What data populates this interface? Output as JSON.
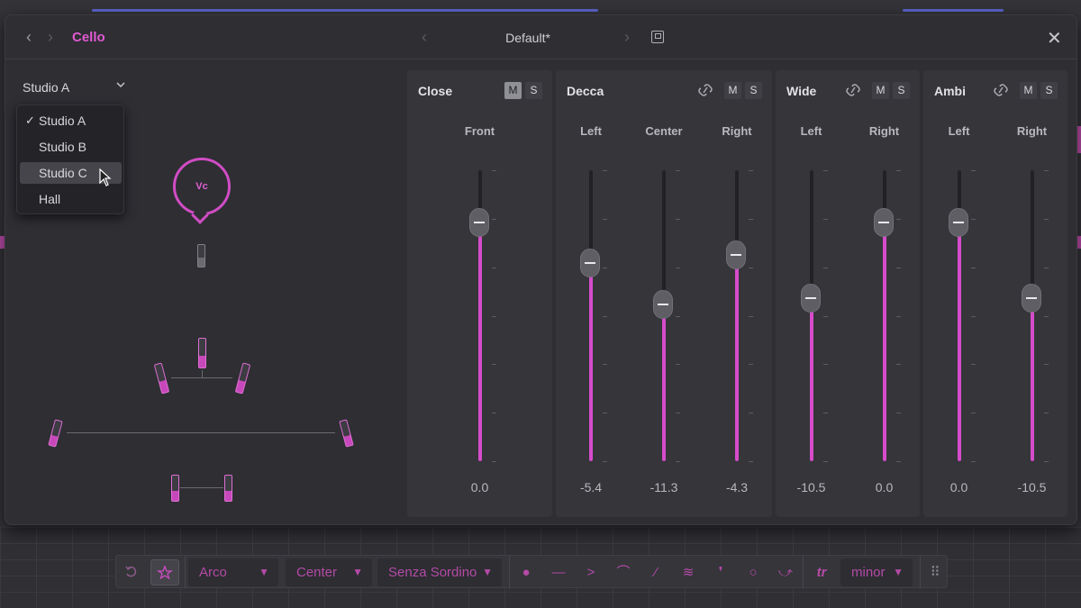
{
  "window": {
    "title": "Cello",
    "preset": "Default*"
  },
  "room": {
    "selected": "Studio A",
    "options": [
      "Studio A",
      "Studio B",
      "Studio C",
      "Hall"
    ],
    "hovered": "Studio C"
  },
  "stage": {
    "instrument": "Vc"
  },
  "panels": [
    {
      "name": "Close",
      "linked": false,
      "mute": "M",
      "solo": "S",
      "mute_on": true,
      "channels": [
        {
          "label": "Front",
          "value": "0.0",
          "level": 0.82
        }
      ]
    },
    {
      "name": "Decca",
      "linked": true,
      "mute": "M",
      "solo": "S",
      "mute_on": false,
      "channels": [
        {
          "label": "Left",
          "value": "-5.4",
          "level": 0.68
        },
        {
          "label": "Center",
          "value": "-11.3",
          "level": 0.54
        },
        {
          "label": "Right",
          "value": "-4.3",
          "level": 0.71
        }
      ]
    },
    {
      "name": "Wide",
      "linked": true,
      "mute": "M",
      "solo": "S",
      "mute_on": false,
      "channels": [
        {
          "label": "Left",
          "value": "-10.5",
          "level": 0.56
        },
        {
          "label": "Right",
          "value": "0.0",
          "level": 0.82
        }
      ]
    },
    {
      "name": "Ambi",
      "linked": true,
      "mute": "M",
      "solo": "S",
      "mute_on": false,
      "channels": [
        {
          "label": "Left",
          "value": "0.0",
          "level": 0.82
        },
        {
          "label": "Right",
          "value": "-10.5",
          "level": 0.56
        }
      ]
    }
  ],
  "toolbar": {
    "articulation": "Arco",
    "position": "Center",
    "mute": "Senza Sordino",
    "mode": "minor"
  },
  "colors": {
    "accent": "#d64ccb",
    "background": "#2e2e33"
  }
}
